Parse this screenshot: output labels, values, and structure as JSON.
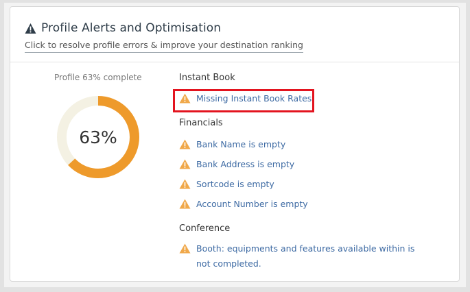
{
  "header": {
    "title": "Profile Alerts and Optimisation",
    "subtitle": "Click to resolve profile errors & improve your destination ranking"
  },
  "profile": {
    "label": "Profile 63% complete",
    "percent_text": "63%",
    "percent": 63
  },
  "sections": [
    {
      "title": "Instant Book",
      "alerts": [
        "Missing Instant Book Rates"
      ]
    },
    {
      "title": "Financials",
      "alerts": [
        "Bank Name is empty",
        "Bank Address is empty",
        "Sortcode is empty",
        "Account Number is empty"
      ]
    },
    {
      "title": "Conference",
      "alerts": [
        "Booth: equipments and features available within is not completed."
      ]
    }
  ],
  "colors": {
    "progress": "#ee9a2b",
    "track": "#f4f1e3",
    "warning": "#f0a84a",
    "link": "#3d6aa3",
    "highlight": "#e3141f"
  },
  "icons": {
    "header": "warning-icon",
    "alert": "warning-icon"
  }
}
